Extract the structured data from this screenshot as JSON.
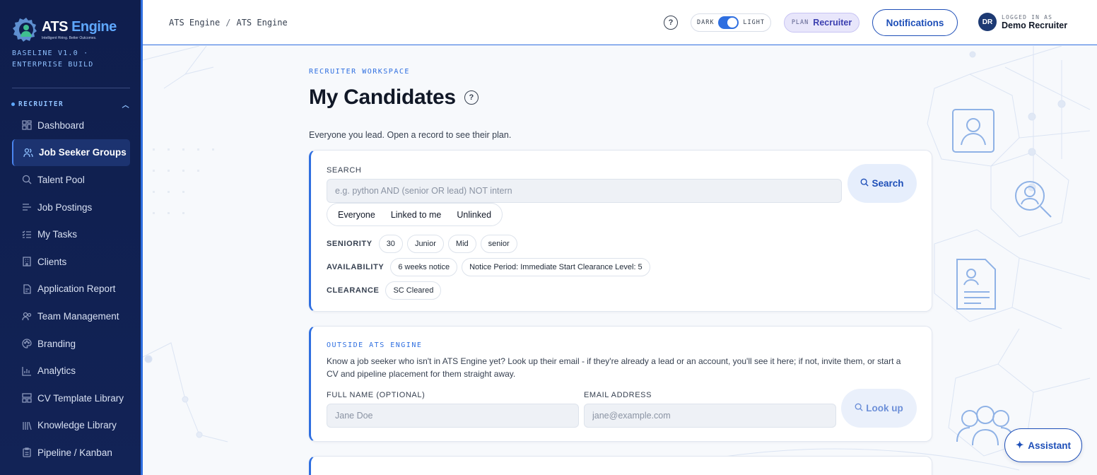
{
  "brand": {
    "name_part1": "ATS",
    "name_part2": "Engine",
    "tagline": "Intelligent Hiring. Better Outcomes.",
    "build": "BASELINE V1.0 · ENTERPRISE BUILD",
    "accent_color": "#2f6fe0"
  },
  "sidebar": {
    "section_label": "RECRUITER",
    "items": [
      {
        "label": "Dashboard",
        "icon": "dashboard-icon"
      },
      {
        "label": "Job Seeker Groups",
        "icon": "users-icon",
        "active": true
      },
      {
        "label": "Talent Pool",
        "icon": "search-icon"
      },
      {
        "label": "Job Postings",
        "icon": "list-icon"
      },
      {
        "label": "My Tasks",
        "icon": "tasks-icon"
      },
      {
        "label": "Clients",
        "icon": "building-icon"
      },
      {
        "label": "Application Report",
        "icon": "report-icon"
      },
      {
        "label": "Team Management",
        "icon": "team-icon"
      },
      {
        "label": "Branding",
        "icon": "palette-icon"
      },
      {
        "label": "Analytics",
        "icon": "chart-icon"
      },
      {
        "label": "CV Template Library",
        "icon": "template-icon"
      },
      {
        "label": "Knowledge Library",
        "icon": "library-icon"
      },
      {
        "label": "Pipeline / Kanban",
        "icon": "clipboard-icon"
      }
    ]
  },
  "header": {
    "breadcrumb": [
      "ATS Engine",
      "ATS Engine"
    ],
    "theme_dark_label": "DARK",
    "theme_light_label": "LIGHT",
    "plan_label": "PLAN",
    "plan_value": "Recruiter",
    "notifications_label": "Notifications",
    "user_initials": "DR",
    "user_caption": "LOGGED IN AS",
    "user_name": "Demo Recruiter"
  },
  "page": {
    "eyebrow": "RECRUITER WORKSPACE",
    "title": "My Candidates",
    "subtitle": "Everyone you lead. Open a record to see their plan."
  },
  "search": {
    "label": "SEARCH",
    "placeholder": "e.g. python AND (senior OR lead) NOT intern",
    "button": "Search",
    "scopes": [
      "Everyone",
      "Linked to me",
      "Unlinked"
    ],
    "facets": [
      {
        "label": "SENIORITY",
        "chips": [
          "30",
          "Junior",
          "Mid",
          "senior"
        ]
      },
      {
        "label": "AVAILABILITY",
        "chips": [
          "6 weeks notice",
          "Notice Period: Immediate Start Clearance Level: 5"
        ]
      },
      {
        "label": "CLEARANCE",
        "chips": [
          "SC Cleared"
        ]
      }
    ]
  },
  "outside": {
    "eyebrow": "OUTSIDE ATS ENGINE",
    "description": "Know a job seeker who isn't in ATS Engine yet? Look up their email - if they're already a lead or an account, you'll see it here; if not, invite them, or start a CV and pipeline placement for them straight away.",
    "name_label": "FULL NAME (OPTIONAL)",
    "name_placeholder": "Jane Doe",
    "email_label": "EMAIL ADDRESS",
    "email_placeholder": "jane@example.com",
    "button": "Look up"
  },
  "assistant": {
    "label": "Assistant"
  }
}
